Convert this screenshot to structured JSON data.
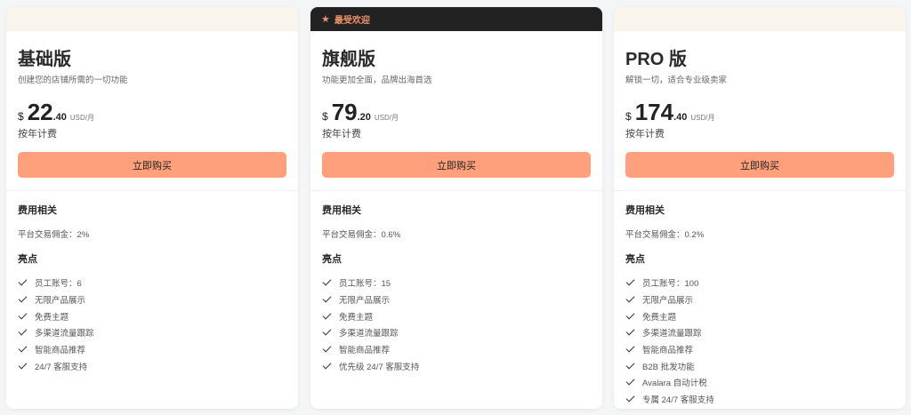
{
  "plans": [
    {
      "badge": "",
      "title": "基础版",
      "desc": "创建您的店铺所需的一切功能",
      "currency": "$",
      "price_int": "22",
      "price_dec": ".40",
      "unit": "USD/月",
      "billing": "按年计费",
      "button": "立即购买",
      "fee_heading": "费用相关",
      "commission": "平台交易佣金：2%",
      "highlights_heading": "亮点",
      "features": [
        "员工账号：6",
        "无限产品展示",
        "免费主题",
        "多渠道流量跟踪",
        "智能商品推荐",
        "24/7 客服支持"
      ]
    },
    {
      "badge": "最受欢迎",
      "badge_icon": "star-icon",
      "title": "旗舰版",
      "desc": "功能更加全面，品牌出海首选",
      "currency": "$",
      "price_int": "79",
      "price_dec": ".20",
      "unit": "USD/月",
      "billing": "按年计费",
      "button": "立即购买",
      "fee_heading": "费用相关",
      "commission": "平台交易佣金：0.6%",
      "highlights_heading": "亮点",
      "features": [
        "员工账号：15",
        "无限产品展示",
        "免费主题",
        "多渠道流量跟踪",
        "智能商品推荐",
        "优先级 24/7 客服支持"
      ]
    },
    {
      "badge": "",
      "title": "PRO 版",
      "desc": "解锁一切，适合专业级卖家",
      "currency": "$",
      "price_int": "174",
      "price_dec": ".40",
      "unit": "USD/月",
      "billing": "按年计费",
      "button": "立即购买",
      "fee_heading": "费用相关",
      "commission": "平台交易佣金：0.2%",
      "highlights_heading": "亮点",
      "features": [
        "员工账号：100",
        "无限产品展示",
        "免费主题",
        "多渠道流量跟踪",
        "智能商品推荐",
        "B2B 批发功能",
        "Avalara 自动计税",
        "专属 24/7 客服支持"
      ]
    }
  ],
  "colors": {
    "accent": "#ffa07c",
    "badge_bg": "#222222",
    "badge_text": "#f0916a",
    "header_light": "#f9f4ec"
  }
}
